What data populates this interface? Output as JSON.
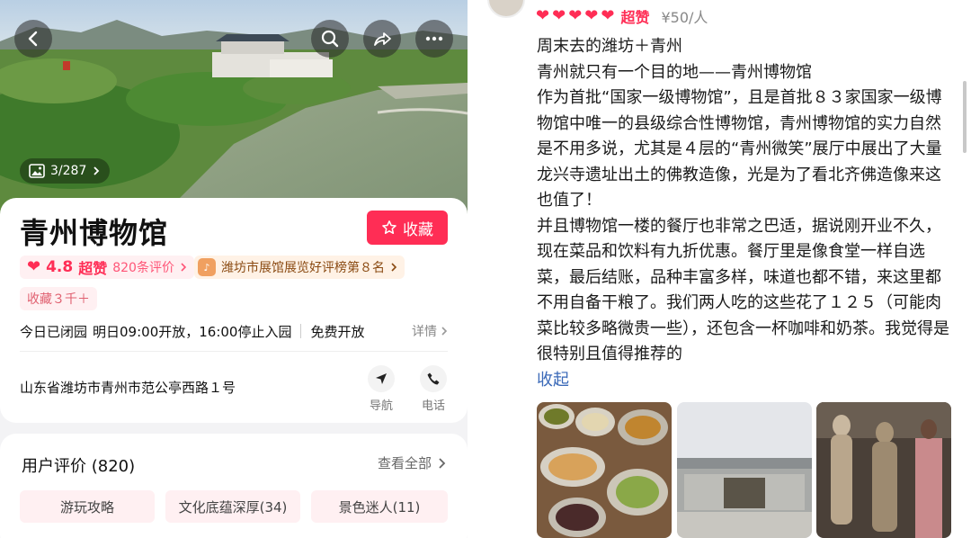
{
  "left_panel": {
    "hero": {
      "photo_count": "3/287"
    },
    "header_buttons": [
      "back-icon",
      "search-icon",
      "share-icon",
      "more-icon"
    ],
    "poi": {
      "title": "青州博物馆",
      "favorite_label": "收藏",
      "rating_score": "4.8",
      "rating_level": "超赞",
      "review_count": "820条评价",
      "rank_text": "潍坊市展馆展览好评榜第８名",
      "collect_text": "收藏３千＋",
      "status_text": "今日已闭园",
      "hours_text": "明日09:00开放，16:00停止入园",
      "fee_text": "免费开放",
      "detail_label": "详情",
      "address": "山东省潍坊市青州市范公亭西路１号",
      "nav_label": "导航",
      "phone_label": "电话"
    },
    "reviews": {
      "title": "用户评价 (820)",
      "view_all": "查看全部",
      "tags": [
        "游玩攻略",
        "文化底蕴深厚(34)",
        "景色迷人(11)"
      ]
    }
  },
  "right_panel": {
    "rating_level": "超赞",
    "hearts": 5,
    "price": "¥50/人",
    "review_lines": "周末去的潍坊＋青州\n青州就只有一个目的地——青州博物馆\n作为首批“国家一级博物馆”，且是首批８３家国家一级博物馆中唯一的县级综合性博物馆，青州博物馆的实力自然是不用多说，尤其是４层的“青州微笑”展厅中展出了大量龙兴寺遗址出土的佛教造像，光是为了看北齐佛造像来这也值了！\n并且博物馆一楼的餐厅也非常之巴适，据说刚开业不久，现在菜品和饮料有九折优惠。餐厅里是像食堂一样自选菜，最后结账，品种丰富多样，味道也都不错，来这里都不用自备干粮了。我们两人吃的这些花了１２５（可能肉菜比较多略微贵一些），还包含一杯咖啡和奶茶。我觉得是很特别且值得推荐的",
    "collapse_label": "收起"
  },
  "colors": {
    "accent": "#ff2d55",
    "link": "#3a69b8"
  }
}
